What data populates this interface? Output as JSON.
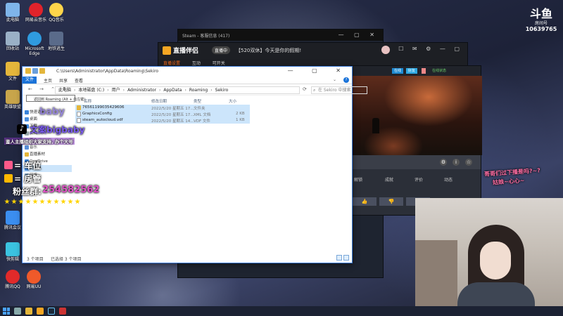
{
  "desktop_icons": [
    {
      "label": "此电脑",
      "color": "#7fb5ea"
    },
    {
      "label": "网易云音乐",
      "color": "#e1232b"
    },
    {
      "label": "QQ音乐",
      "color": "#ffd54a"
    },
    {
      "label": "回收站",
      "color": "#9ab0c6"
    },
    {
      "label": "Microsoft Edge",
      "color": "#2f9be0"
    },
    {
      "label": "地铁逃生",
      "color": "#5a6b8a"
    },
    {
      "label": "文件",
      "color": "#e4b63b"
    },
    {
      "label": "英雄联盟",
      "color": "#c8a54b"
    },
    {
      "label": "腾讯会议",
      "color": "#3b8ef0"
    },
    {
      "label": "快剪辑",
      "color": "#3bc3e0"
    },
    {
      "label": "uTorrent",
      "color": "#59b44b"
    },
    {
      "label": "网易UU",
      "color": "#f05a2a"
    },
    {
      "label": "腾讯QQ",
      "color": "#e12a2a"
    }
  ],
  "steam_window": {
    "title": "Steam - 客服信息 (417)"
  },
  "live_app": {
    "logo": "直播伴侣",
    "badge": "直播中",
    "title": "【520双休】今天是你的假期!",
    "tabs": [
      "直播设置",
      "互动",
      "可开关"
    ],
    "active_tab": 0
  },
  "game_window": {
    "btn1": "在线",
    "btn2": "好友",
    "btn3": "在线状态",
    "stats": [
      "解锁",
      "成就",
      "评价",
      "动态"
    ],
    "rating_up": "👍",
    "rating_down": "👎",
    "rating_more": "▾"
  },
  "explorer": {
    "title_path": "C:\\Users\\Administrator\\AppData\\Roaming\\Sekiro",
    "ribbon": {
      "file": "文件",
      "home": "主页",
      "share": "共享",
      "view": "查看"
    },
    "address": [
      "此电脑",
      "本地磁盘 (C:)",
      "用户",
      "Administrator",
      "AppData",
      "Roaming",
      "Sekiro"
    ],
    "search_placeholder": "在 Sekiro 中搜索",
    "tooltip": "返回到 Roaming (Alt + 向左键)",
    "tree": [
      "快速访问",
      "桌面",
      "下载",
      "文档",
      "图片",
      "音乐",
      "直播素材",
      "OneDrive",
      "此电脑",
      "网络"
    ],
    "columns": {
      "name": "名称",
      "date": "修改日期",
      "type": "类型",
      "size": "大小"
    },
    "files": [
      {
        "name": "76561199035429606",
        "date": "2022/5/20 星期五 17...",
        "type": "文件夹",
        "size": ""
      },
      {
        "name": "GraphicsConfig",
        "date": "2022/5/20 星期五 17...",
        "type": "XML 文档",
        "size": "2 KB"
      },
      {
        "name": "steam_autocloud.vdf",
        "date": "2022/5/20 星期五 14...",
        "type": "VDF 文件",
        "size": "1 KB"
      }
    ],
    "status_count": "3 个项目",
    "status_selected": "已选择 3 个项目"
  },
  "overlay": {
    "tiktok_id": "文案bigbaby",
    "watermark": "baby",
    "promo": "鉴人主播组织大家支持, 办个大号",
    "car_label": "= 车位",
    "guard_label": "= 房管",
    "fans_label": "粉丝群:",
    "fans_number": "254582562",
    "stars": 11,
    "side_msg_line1": "哥哥们过下播是吗?~?",
    "side_msg_line2": "姑娘~心心~"
  },
  "douyu": {
    "logo": "斗鱼",
    "room_label": "房间号",
    "room_number": "10639765"
  }
}
